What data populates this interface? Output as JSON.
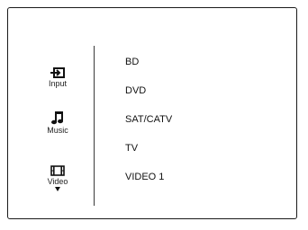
{
  "sidebar": {
    "categories": [
      {
        "label": "Input",
        "icon": "input-icon"
      },
      {
        "label": "Music",
        "icon": "music-note-icon"
      },
      {
        "label": "Video",
        "icon": "film-icon"
      }
    ],
    "more_indicator": "chevron-down-icon"
  },
  "main": {
    "items": [
      "BD",
      "DVD",
      "SAT/CATV",
      "TV",
      "VIDEO 1"
    ]
  }
}
